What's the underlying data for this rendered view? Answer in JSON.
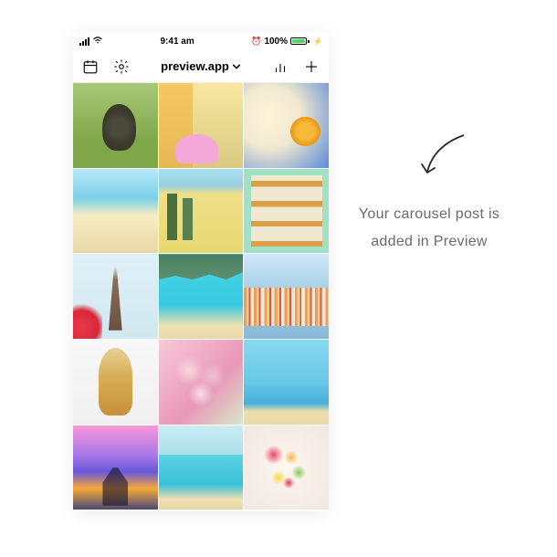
{
  "status": {
    "time": "9:41 am",
    "battery_pct": "100%",
    "alarm_visible": true
  },
  "header": {
    "app_name": "preview.app"
  },
  "annotation": {
    "text": "Your carousel post is added in Preview"
  }
}
